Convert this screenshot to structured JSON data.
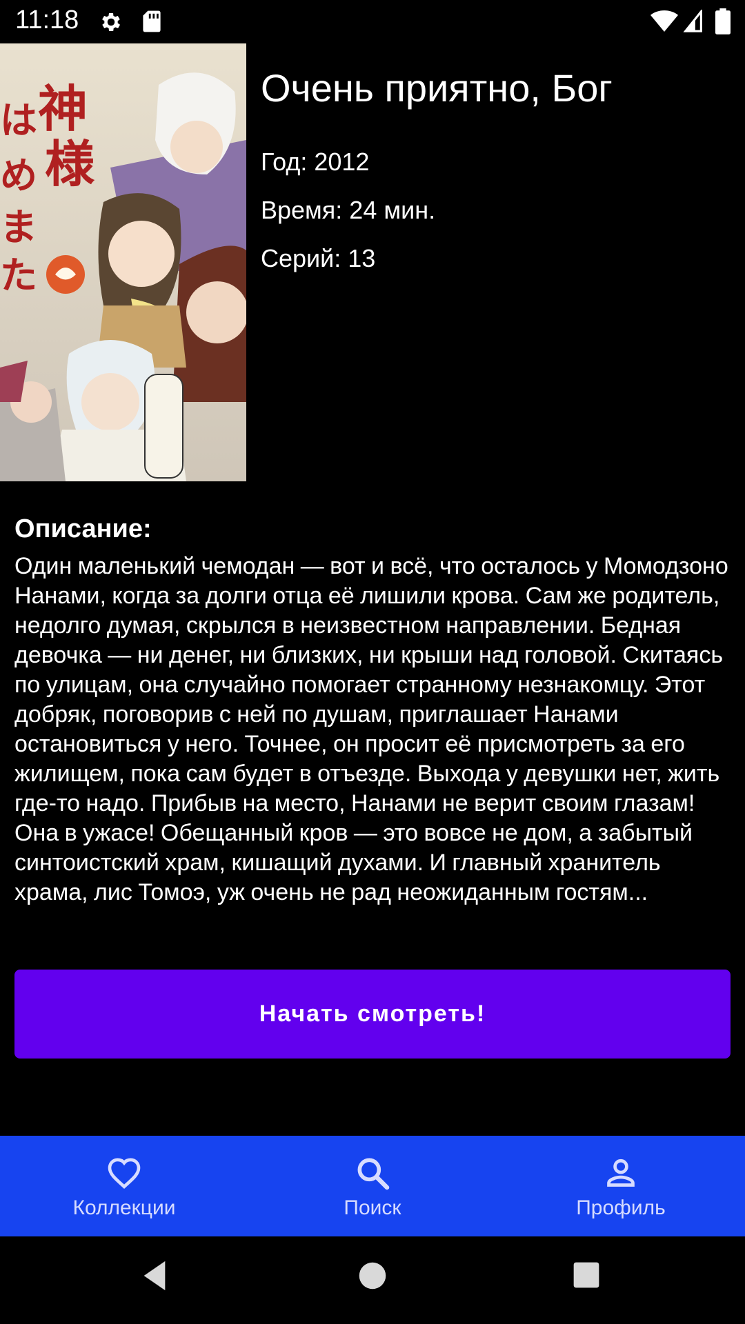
{
  "status_bar": {
    "time": "11:18",
    "icons": [
      "gear-icon",
      "sd-card-icon",
      "wifi-icon",
      "signal-icon",
      "battery-icon"
    ]
  },
  "anime": {
    "title": "Очень приятно, Бог",
    "year": "Год: 2012",
    "duration": "Время: 24 мин.",
    "episodes": "Серий: 13",
    "description_label": "Описание:",
    "description": "Один маленький чемодан — вот и всё, что осталось у Момодзоно Нанами, когда за долги отца её лишили крова. Сам же родитель, недолго думая, скрылся в неизвестном направлении. Бедная девочка — ни денег, ни близких, ни крыши над головой. Скитаясь по улицам, она случайно помогает странному незнакомцу. Этот добряк, поговорив с ней по душам, приглашает Нанами остановиться у него. Точнее, он просит её присмотреть за его жилищем, пока сам будет в отъезде. Выхода у девушки нет, жить где-то надо. Прибыв на место, Нанами не верит своим глазам! Она в ужасе! Обещанный кров — это вовсе не дом, а забытый синтоистский храм, кишащий духами. И главный хранитель храма, лис Томоэ, уж очень не рад неожиданным гостям..."
  },
  "actions": {
    "watch_label": "Начать смотреть!"
  },
  "bottom_nav": {
    "items": [
      {
        "label": "Коллекции",
        "icon": "heart-icon"
      },
      {
        "label": "Поиск",
        "icon": "search-icon"
      },
      {
        "label": "Профиль",
        "icon": "person-icon"
      }
    ]
  },
  "colors": {
    "button": "#6200ee",
    "bottom_nav": "#1744f0",
    "background": "#000000"
  },
  "system_nav": {
    "icons": [
      "back-icon",
      "home-icon",
      "recents-icon"
    ]
  }
}
